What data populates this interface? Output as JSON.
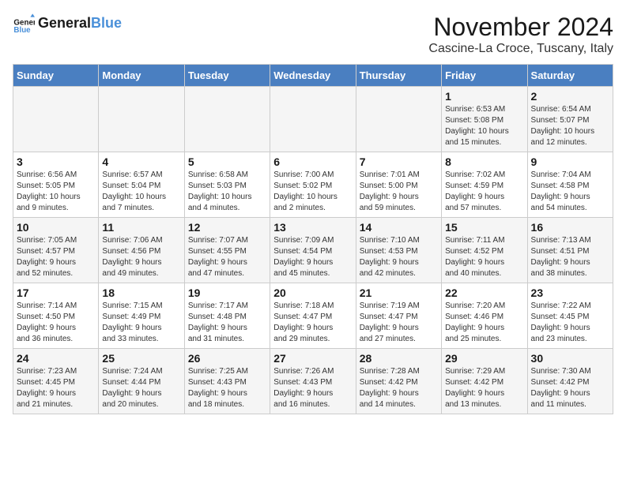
{
  "app": {
    "name": "GeneralBlue",
    "logo_text_line1": "General",
    "logo_text_line2": "Blue"
  },
  "header": {
    "month": "November 2024",
    "location": "Cascine-La Croce, Tuscany, Italy"
  },
  "weekdays": [
    "Sunday",
    "Monday",
    "Tuesday",
    "Wednesday",
    "Thursday",
    "Friday",
    "Saturday"
  ],
  "weeks": [
    [
      {
        "day": "",
        "info": ""
      },
      {
        "day": "",
        "info": ""
      },
      {
        "day": "",
        "info": ""
      },
      {
        "day": "",
        "info": ""
      },
      {
        "day": "",
        "info": ""
      },
      {
        "day": "1",
        "info": "Sunrise: 6:53 AM\nSunset: 5:08 PM\nDaylight: 10 hours\nand 15 minutes."
      },
      {
        "day": "2",
        "info": "Sunrise: 6:54 AM\nSunset: 5:07 PM\nDaylight: 10 hours\nand 12 minutes."
      }
    ],
    [
      {
        "day": "3",
        "info": "Sunrise: 6:56 AM\nSunset: 5:05 PM\nDaylight: 10 hours\nand 9 minutes."
      },
      {
        "day": "4",
        "info": "Sunrise: 6:57 AM\nSunset: 5:04 PM\nDaylight: 10 hours\nand 7 minutes."
      },
      {
        "day": "5",
        "info": "Sunrise: 6:58 AM\nSunset: 5:03 PM\nDaylight: 10 hours\nand 4 minutes."
      },
      {
        "day": "6",
        "info": "Sunrise: 7:00 AM\nSunset: 5:02 PM\nDaylight: 10 hours\nand 2 minutes."
      },
      {
        "day": "7",
        "info": "Sunrise: 7:01 AM\nSunset: 5:00 PM\nDaylight: 9 hours\nand 59 minutes."
      },
      {
        "day": "8",
        "info": "Sunrise: 7:02 AM\nSunset: 4:59 PM\nDaylight: 9 hours\nand 57 minutes."
      },
      {
        "day": "9",
        "info": "Sunrise: 7:04 AM\nSunset: 4:58 PM\nDaylight: 9 hours\nand 54 minutes."
      }
    ],
    [
      {
        "day": "10",
        "info": "Sunrise: 7:05 AM\nSunset: 4:57 PM\nDaylight: 9 hours\nand 52 minutes."
      },
      {
        "day": "11",
        "info": "Sunrise: 7:06 AM\nSunset: 4:56 PM\nDaylight: 9 hours\nand 49 minutes."
      },
      {
        "day": "12",
        "info": "Sunrise: 7:07 AM\nSunset: 4:55 PM\nDaylight: 9 hours\nand 47 minutes."
      },
      {
        "day": "13",
        "info": "Sunrise: 7:09 AM\nSunset: 4:54 PM\nDaylight: 9 hours\nand 45 minutes."
      },
      {
        "day": "14",
        "info": "Sunrise: 7:10 AM\nSunset: 4:53 PM\nDaylight: 9 hours\nand 42 minutes."
      },
      {
        "day": "15",
        "info": "Sunrise: 7:11 AM\nSunset: 4:52 PM\nDaylight: 9 hours\nand 40 minutes."
      },
      {
        "day": "16",
        "info": "Sunrise: 7:13 AM\nSunset: 4:51 PM\nDaylight: 9 hours\nand 38 minutes."
      }
    ],
    [
      {
        "day": "17",
        "info": "Sunrise: 7:14 AM\nSunset: 4:50 PM\nDaylight: 9 hours\nand 36 minutes."
      },
      {
        "day": "18",
        "info": "Sunrise: 7:15 AM\nSunset: 4:49 PM\nDaylight: 9 hours\nand 33 minutes."
      },
      {
        "day": "19",
        "info": "Sunrise: 7:17 AM\nSunset: 4:48 PM\nDaylight: 9 hours\nand 31 minutes."
      },
      {
        "day": "20",
        "info": "Sunrise: 7:18 AM\nSunset: 4:47 PM\nDaylight: 9 hours\nand 29 minutes."
      },
      {
        "day": "21",
        "info": "Sunrise: 7:19 AM\nSunset: 4:47 PM\nDaylight: 9 hours\nand 27 minutes."
      },
      {
        "day": "22",
        "info": "Sunrise: 7:20 AM\nSunset: 4:46 PM\nDaylight: 9 hours\nand 25 minutes."
      },
      {
        "day": "23",
        "info": "Sunrise: 7:22 AM\nSunset: 4:45 PM\nDaylight: 9 hours\nand 23 minutes."
      }
    ],
    [
      {
        "day": "24",
        "info": "Sunrise: 7:23 AM\nSunset: 4:45 PM\nDaylight: 9 hours\nand 21 minutes."
      },
      {
        "day": "25",
        "info": "Sunrise: 7:24 AM\nSunset: 4:44 PM\nDaylight: 9 hours\nand 20 minutes."
      },
      {
        "day": "26",
        "info": "Sunrise: 7:25 AM\nSunset: 4:43 PM\nDaylight: 9 hours\nand 18 minutes."
      },
      {
        "day": "27",
        "info": "Sunrise: 7:26 AM\nSunset: 4:43 PM\nDaylight: 9 hours\nand 16 minutes."
      },
      {
        "day": "28",
        "info": "Sunrise: 7:28 AM\nSunset: 4:42 PM\nDaylight: 9 hours\nand 14 minutes."
      },
      {
        "day": "29",
        "info": "Sunrise: 7:29 AM\nSunset: 4:42 PM\nDaylight: 9 hours\nand 13 minutes."
      },
      {
        "day": "30",
        "info": "Sunrise: 7:30 AM\nSunset: 4:42 PM\nDaylight: 9 hours\nand 11 minutes."
      }
    ]
  ]
}
